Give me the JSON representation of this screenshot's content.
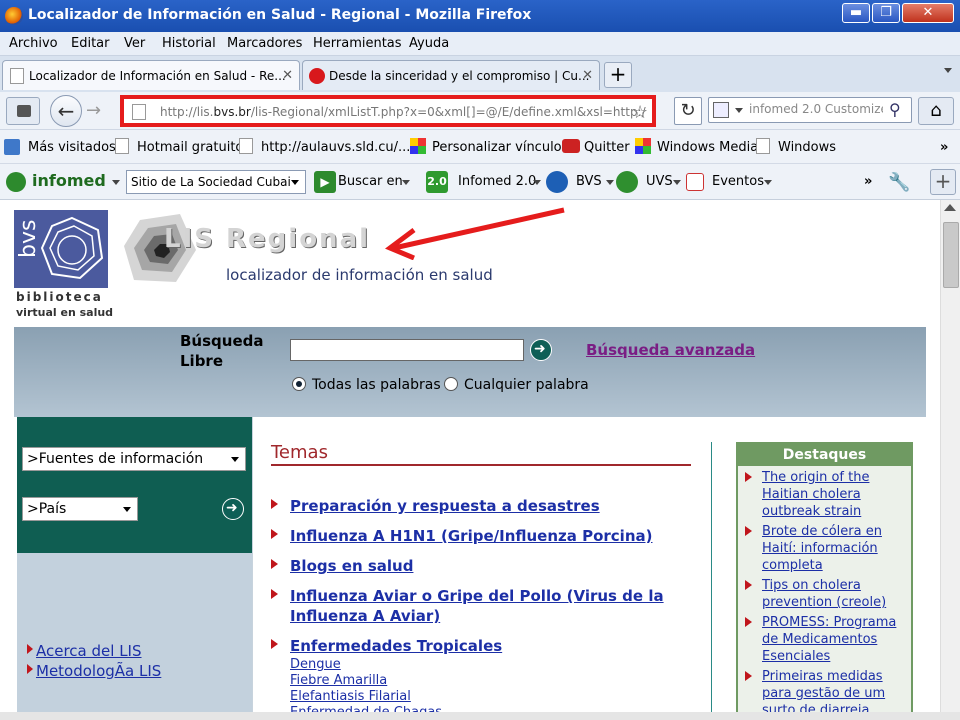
{
  "window": {
    "title": "Localizador de Información en Salud - Regional - Mozilla Firefox",
    "minimize": "▬",
    "maximize": "❐",
    "close": "✕"
  },
  "menu": [
    "Archivo",
    "Editar",
    "Ver",
    "Historial",
    "Marcadores",
    "Herramientas",
    "Ayuda"
  ],
  "tabs": [
    {
      "label": "Localizador de Información en Salud - Re...",
      "close": "✕"
    },
    {
      "label": "Desde la sinceridad y el compromiso | Cu...",
      "close": "✕"
    }
  ],
  "new_tab": "+",
  "url": {
    "prefix": "http://lis.",
    "domain": "bvs.br",
    "rest": "/lis-Regional/xmlListT.php?x=0&xml[]=@/E/define.xml&xsl=http:/",
    "star": "☆",
    "reload": "↻"
  },
  "search": {
    "value": "infomed 2.0 Customize"
  },
  "bookmarks": [
    "Más visitados",
    "Hotmail gratuito",
    "http://aulauvs.sld.cu/...",
    "Personalizar vínculos",
    "Quitter",
    "Windows Media",
    "Windows"
  ],
  "bookmarks_more": "»",
  "infobar": {
    "brand": "infomed",
    "site": "Sitio de La Sociedad Cubai",
    "buscar": "Buscar en",
    "badge": "2.0",
    "items": [
      "Infomed 2.0",
      "BVS",
      "UVS",
      "Eventos"
    ],
    "more": "»"
  },
  "logo": {
    "bvs": "bvs",
    "biblioteca": "biblioteca",
    "virtual": "virtual en salud",
    "lis_title": "LIS Regional",
    "lis_subtitle": "localizador de información en salud"
  },
  "search_panel": {
    "label": "Búsqueda Libre",
    "advanced": "Búsqueda avanzada",
    "opt_all": "Todas las palabras",
    "opt_any": "Cualquier palabra"
  },
  "left": {
    "select1": ">Fuentes de información",
    "select2": ">País",
    "links": [
      "Acerca del LIS",
      "MetodologÃ­a LIS"
    ]
  },
  "temas": {
    "heading": "Temas",
    "items": [
      "Preparación y respuesta a desastres",
      "Influenza A H1N1 (Gripe/Influenza Porcina)",
      "Blogs en salud",
      "Influenza Aviar o Gripe del Pollo (Virus de la Influenza A Aviar)",
      "Enfermedades Tropicales"
    ],
    "subitems": [
      "Dengue",
      "Fiebre Amarilla",
      "Elefantiasis Filarial",
      "Enfermedad de Chagas"
    ]
  },
  "destaques": {
    "heading": "Destaques",
    "items": [
      "The origin of the Haitian cholera outbreak strain",
      "Brote de cólera en Haití: información completa",
      "Tips on cholera prevention (creole)",
      "PROMESS: Programa de Medicamentos Esenciales",
      "Primeiras medidas para gestão de um surto de diarreia"
    ]
  },
  "colors": {
    "annotation": "#e51c1c",
    "link": "#1c2fa6",
    "panel": "#0f5e52",
    "accent_bullet": "#c0161c"
  }
}
